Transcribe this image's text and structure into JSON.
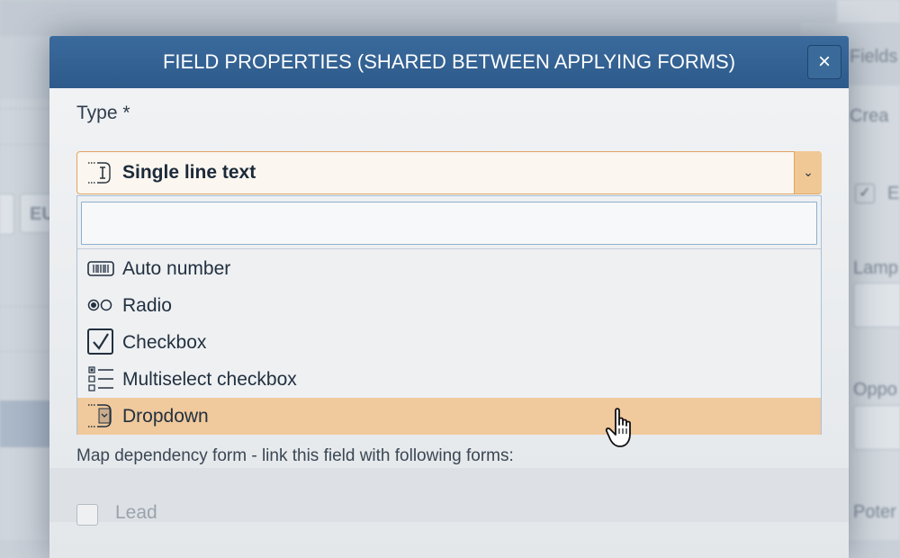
{
  "background": {
    "left_field_text": "EU",
    "right_texts": [
      "Fields",
      "Crea",
      "E",
      "Lamp",
      "Oppo",
      "Poter"
    ]
  },
  "modal": {
    "title": "FIELD PROPERTIES (SHARED BETWEEN APPLYING FORMS)",
    "close_icon": "×",
    "type_label": "Type *",
    "selected_type": "Single line text",
    "caret_icon": "⌄",
    "search_value": "",
    "options": [
      {
        "label": "Auto number",
        "icon": "barcode-icon"
      },
      {
        "label": "Radio",
        "icon": "radio-icon"
      },
      {
        "label": "Checkbox",
        "icon": "checkbox-icon"
      },
      {
        "label": "Multiselect checkbox",
        "icon": "multiselect-icon"
      },
      {
        "label": "Dropdown",
        "icon": "dropdown-icon",
        "highlighted": true
      }
    ],
    "map_dependency_text": "Map dependency form - link this field with following forms:",
    "forms": [
      {
        "label": "Lead",
        "checked": false
      }
    ]
  },
  "colors": {
    "header": "#2d5a8b",
    "select_border": "#e0a562",
    "highlight": "#f0c99c"
  }
}
